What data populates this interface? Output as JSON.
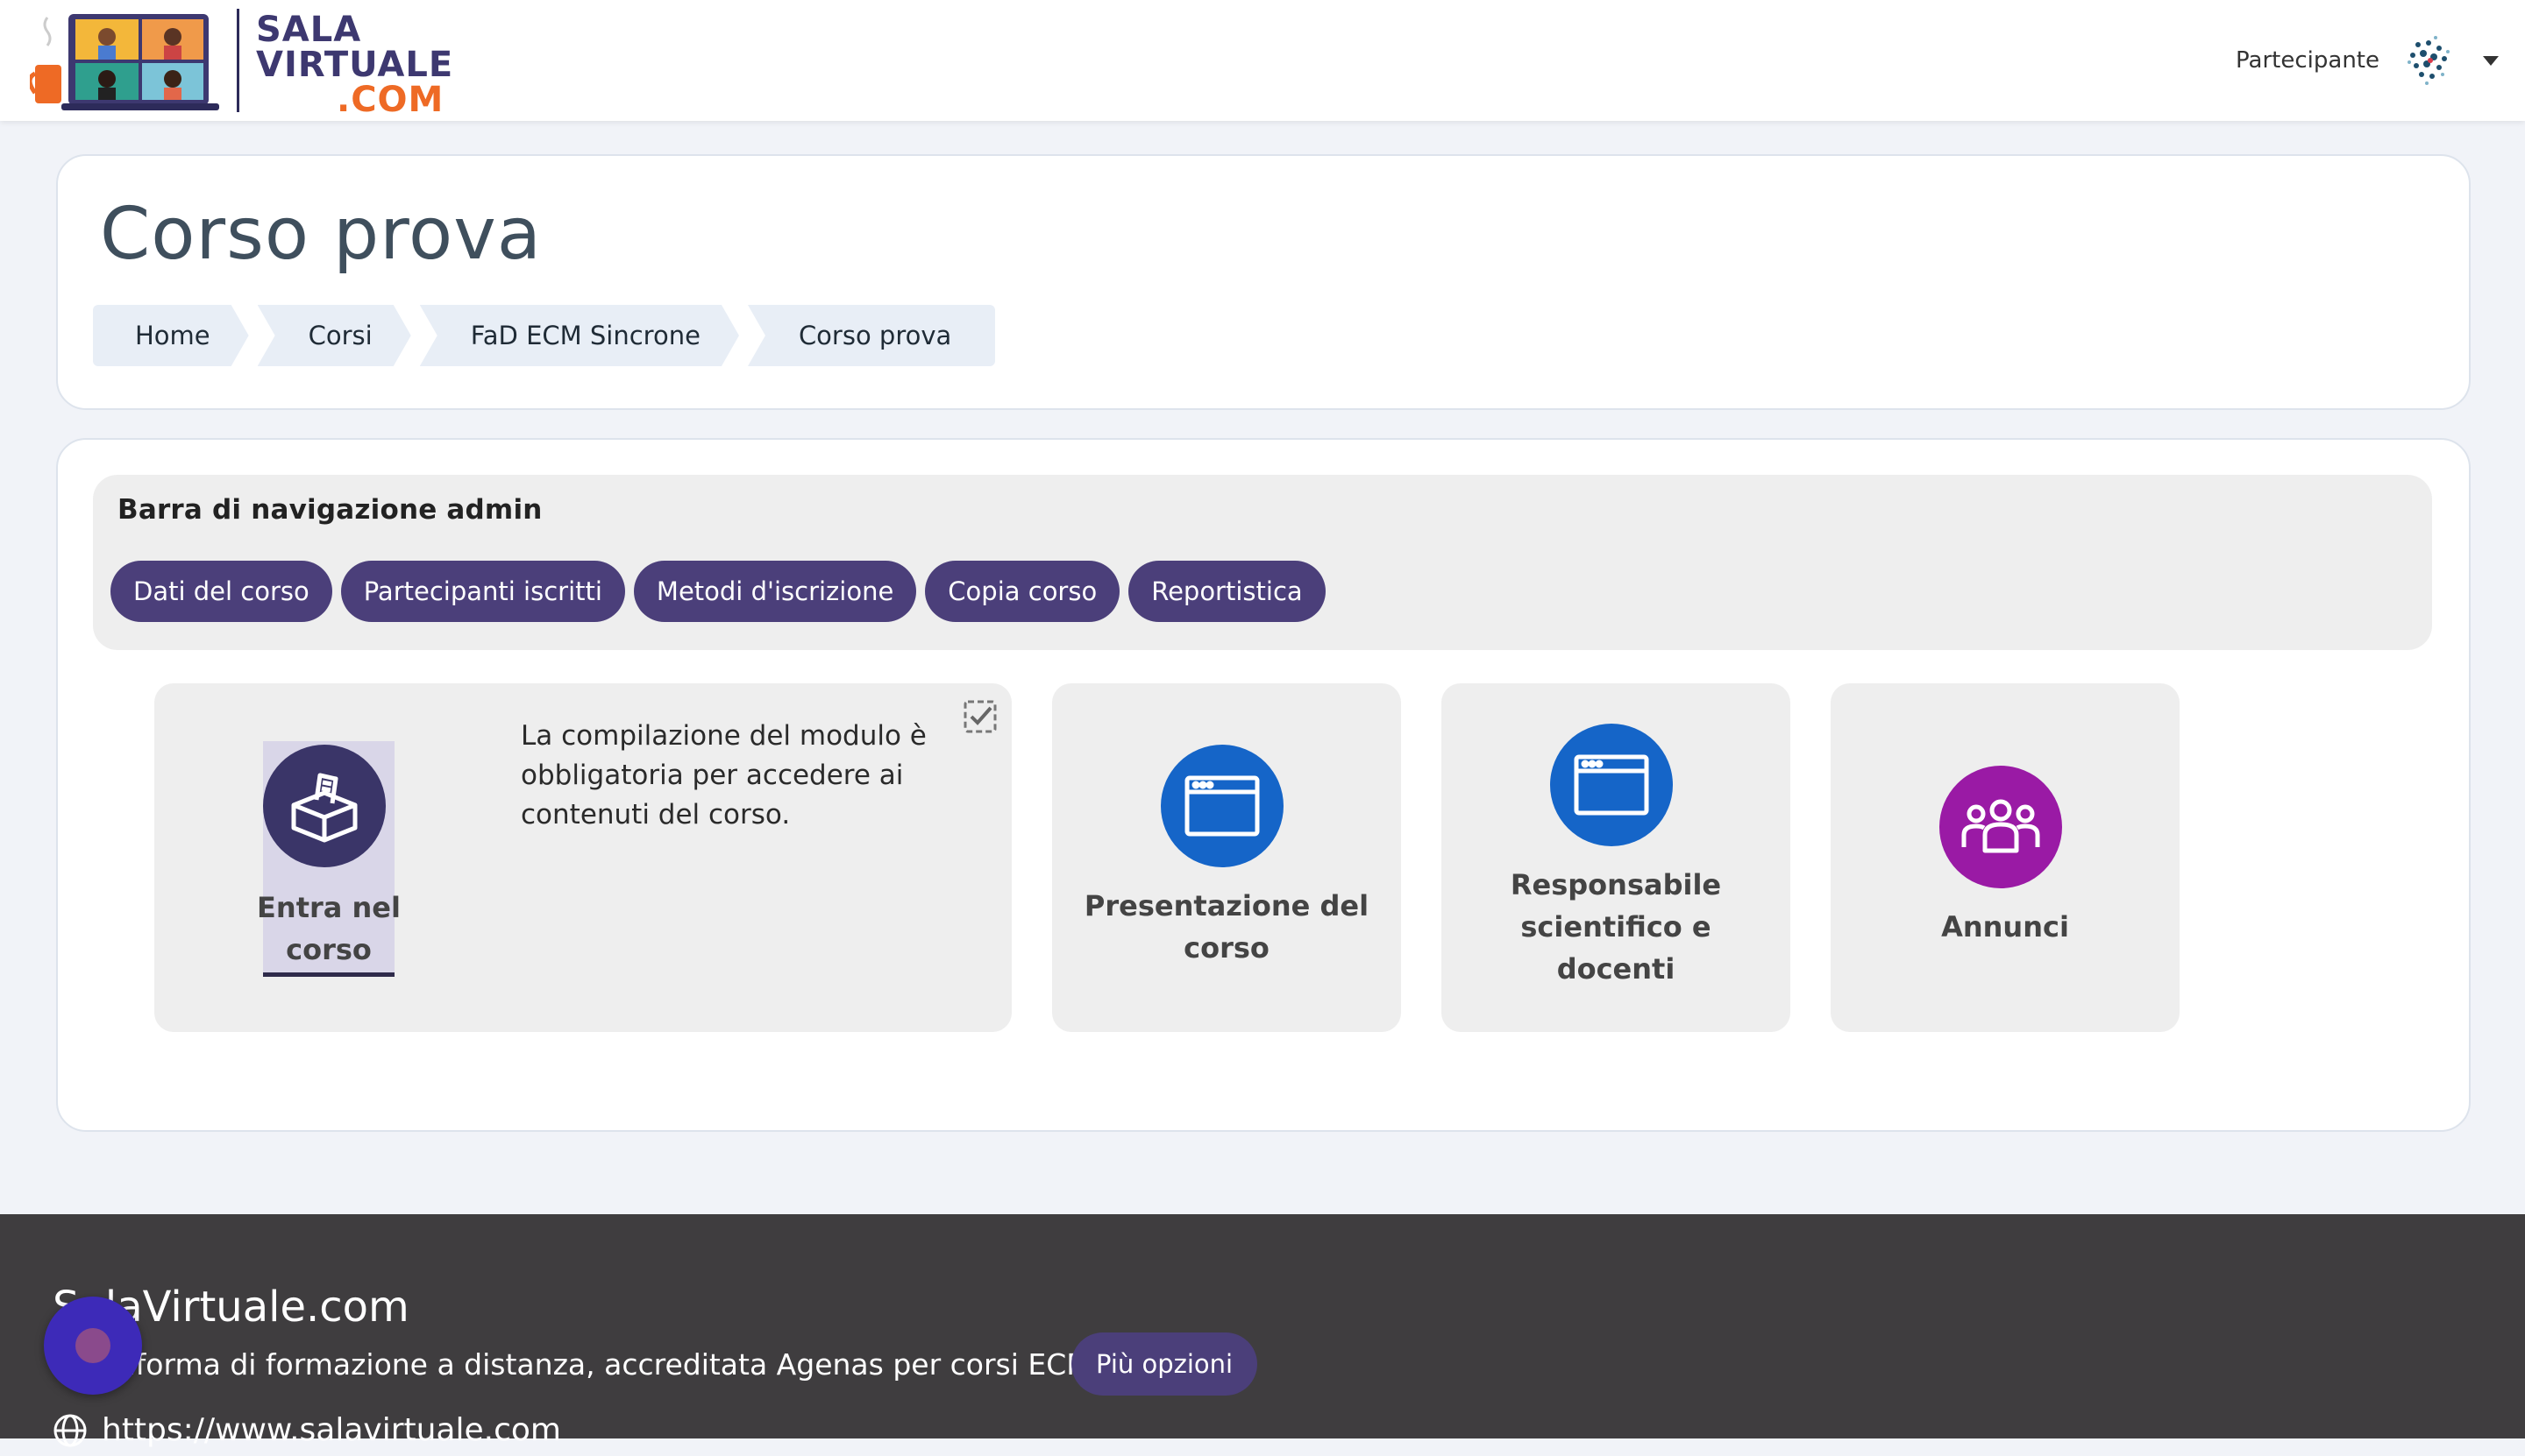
{
  "brand": {
    "line1": "SALA",
    "line2": "VIRTUALE",
    "line3": ".COM",
    "colors": {
      "navy": "#3d3870",
      "orange": "#ee6a25"
    }
  },
  "user": {
    "name": "Partecipante",
    "avatar_icon": "avatar-icon",
    "menu_icon": "caret-down-icon"
  },
  "page": {
    "title": "Corso prova",
    "breadcrumb": [
      "Home",
      "Corsi",
      "FaD ECM Sincrone",
      "Corso prova"
    ]
  },
  "admin_nav": {
    "title": "Barra di navigazione admin",
    "buttons": [
      "Dati del corso",
      "Partecipanti iscritti",
      "Metodi d'iscrizione",
      "Copia corso",
      "Reportistica"
    ],
    "button_color": "#4b3f7a"
  },
  "tiles": {
    "enter": {
      "label": "Entra nel corso",
      "description": "La compilazione del modulo è obbligatoria per accedere ai contenuti del corso.",
      "icon": "ballot-box-icon",
      "color": "#3a3568"
    },
    "presentation": {
      "label": "Presentazione del corso",
      "icon": "browser-window-icon",
      "color": "#1565c8"
    },
    "responsible": {
      "label": "Responsabile scientifico e docenti",
      "icon": "browser-window-icon",
      "color": "#1565c8"
    },
    "announcements": {
      "label": "Annunci",
      "icon": "users-group-icon",
      "color": "#9a1aa5"
    }
  },
  "footer": {
    "title": "SalaVirtuale.com",
    "description": "Piattaforma di formazione a distanza, accreditata Agenas per corsi ECM",
    "more_button": "Più opzioni",
    "url": "https://www.salavirtuale.com"
  }
}
